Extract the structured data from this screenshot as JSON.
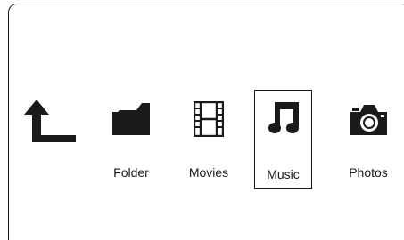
{
  "menu": {
    "items": [
      {
        "id": "back",
        "icon": "back-arrow-icon",
        "label": ""
      },
      {
        "id": "folder",
        "icon": "folder-icon",
        "label": "Folder"
      },
      {
        "id": "movies",
        "icon": "film-strip-icon",
        "label": "Movies"
      },
      {
        "id": "music",
        "icon": "music-note-icon",
        "label": "Music",
        "selected": true
      },
      {
        "id": "photos",
        "icon": "camera-icon",
        "label": "Photos"
      }
    ]
  }
}
